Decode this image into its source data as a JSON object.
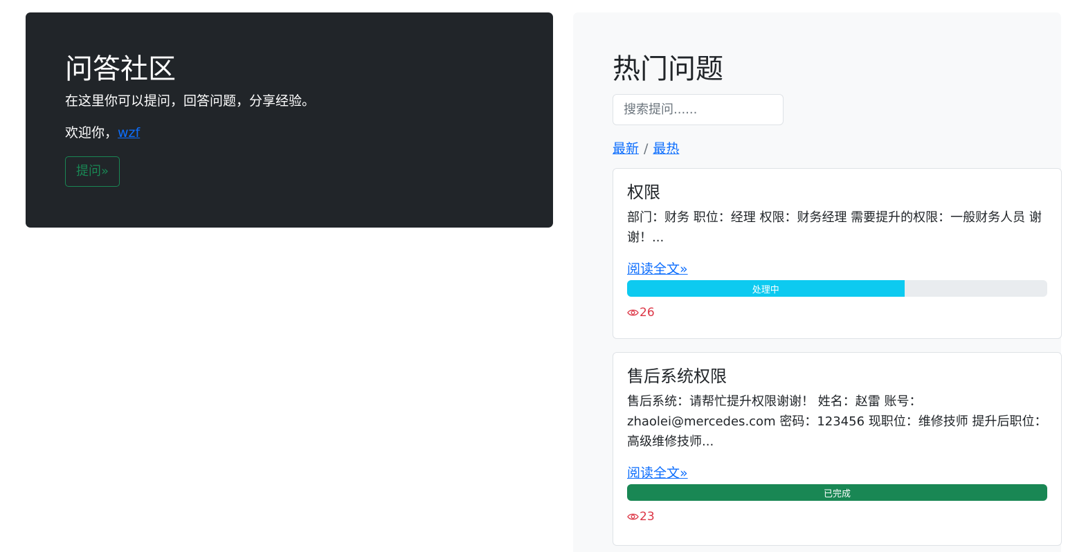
{
  "hero": {
    "title": "问答社区",
    "lead": "在这里你可以提问，回答问题，分享经验。",
    "welcome_prefix": "欢迎你，",
    "username": "wzf",
    "ask_button": "提问»"
  },
  "sidebar": {
    "title": "热门问题",
    "search_placeholder": "搜索提问......",
    "sort_latest": "最新",
    "sort_separator": "/",
    "sort_hottest": "最热"
  },
  "questions": [
    {
      "title": "权限",
      "body": "部门：财务 职位：经理 权限：财务经理 需要提升的权限：一般财务人员 谢谢！...",
      "read_more": "阅读全文»",
      "status": "处理中",
      "progress_percent": 66,
      "status_color": "#0dcaf0",
      "views": "26"
    },
    {
      "title": "售后系统权限",
      "body": "售后系统：请帮忙提升权限谢谢！ 姓名：赵雷 账号：zhaolei@mercedes.com 密码：123456 现职位：维修技师 提升后职位：高级维修技师...",
      "read_more": "阅读全文»",
      "status": "已完成",
      "progress_percent": 100,
      "status_color": "#198754",
      "views": "23"
    }
  ]
}
